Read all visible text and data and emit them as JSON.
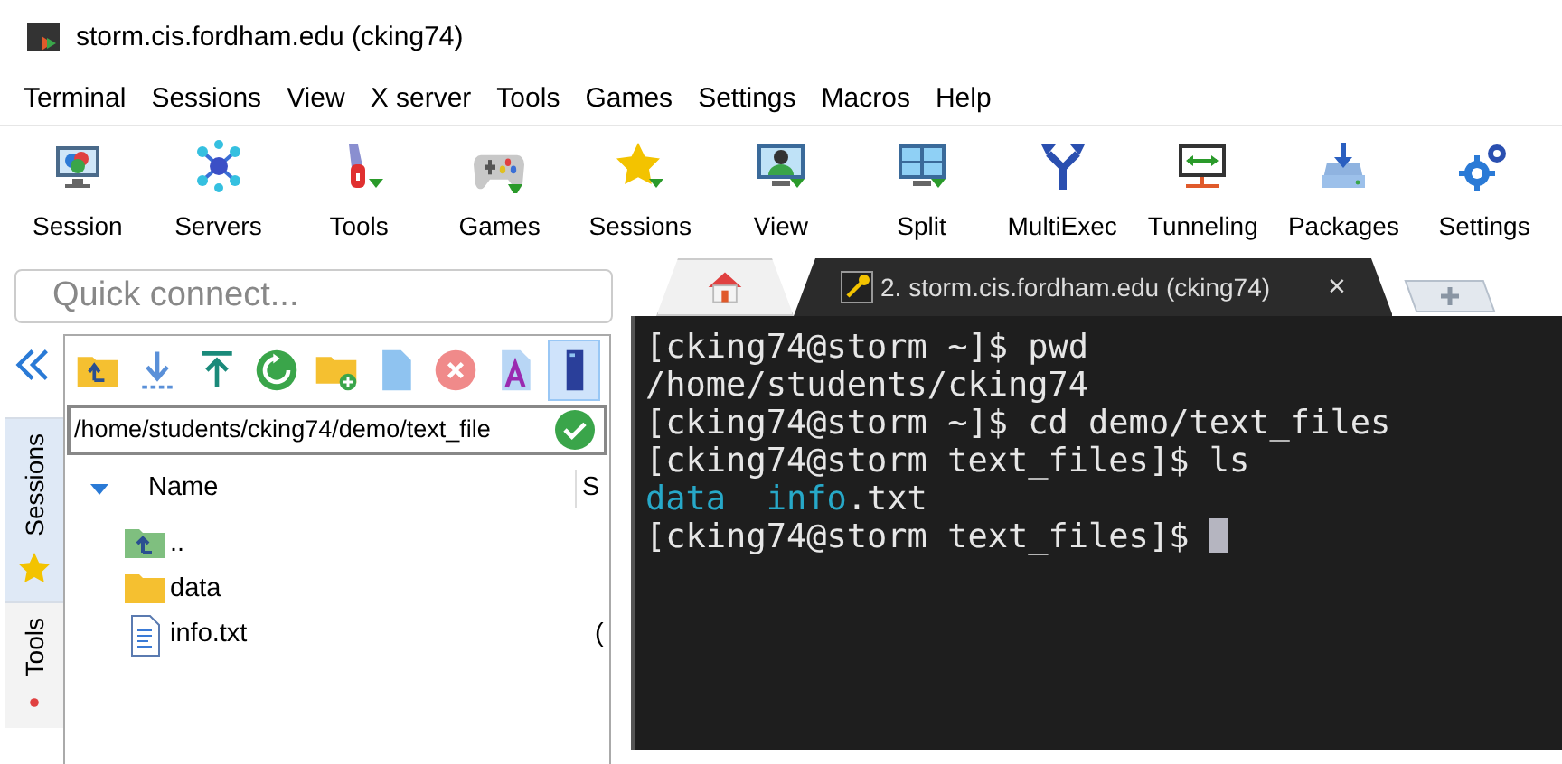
{
  "window": {
    "title": "storm.cis.fordham.edu (cking74)"
  },
  "menu": [
    "Terminal",
    "Sessions",
    "View",
    "X server",
    "Tools",
    "Games",
    "Settings",
    "Macros",
    "Help"
  ],
  "toolbar": [
    {
      "label": "Session"
    },
    {
      "label": "Servers"
    },
    {
      "label": "Tools"
    },
    {
      "label": "Games"
    },
    {
      "label": "Sessions"
    },
    {
      "label": "View"
    },
    {
      "label": "Split"
    },
    {
      "label": "MultiExec"
    },
    {
      "label": "Tunneling"
    },
    {
      "label": "Packages"
    },
    {
      "label": "Settings"
    }
  ],
  "quick_connect": {
    "placeholder": "Quick connect..."
  },
  "side_tabs": [
    {
      "label": "Sessions",
      "selected": true
    },
    {
      "label": "Tools",
      "selected": false
    }
  ],
  "file_toolbar": [
    {
      "selected": false
    },
    {
      "selected": false
    },
    {
      "selected": false
    },
    {
      "selected": false
    },
    {
      "selected": false
    },
    {
      "selected": false
    },
    {
      "selected": false
    },
    {
      "selected": false
    },
    {
      "selected": true
    }
  ],
  "path": {
    "value": "/home/students/cking74/demo/text_file"
  },
  "file_columns": [
    "Name",
    "S"
  ],
  "files": [
    {
      "kind": "parent",
      "name": ".."
    },
    {
      "kind": "folder",
      "name": "data"
    },
    {
      "kind": "file",
      "name": "info.txt",
      "column_2": "("
    }
  ],
  "tabs": [
    {
      "kind": "home",
      "selected": false
    },
    {
      "kind": "session",
      "label": "2. storm.cis.fordham.edu (cking74)",
      "close": "×",
      "selected": true
    }
  ],
  "terminal": [
    [
      {
        "kind": "plain",
        "text": "[cking74@storm ~]$ pwd"
      }
    ],
    [
      {
        "kind": "plain",
        "text": "/home/students/cking74"
      }
    ],
    [
      {
        "kind": "plain",
        "text": "[cking74@storm ~]$ cd demo/text_files"
      }
    ],
    [
      {
        "kind": "plain",
        "text": "[cking74@storm text_files]$ ls"
      }
    ],
    [
      {
        "kind": "dir",
        "text": "data"
      },
      {
        "kind": "dir",
        "text": "info",
        "space_before": true
      },
      {
        "kind": "plain",
        "text": ".txt"
      }
    ],
    [
      {
        "kind": "plain",
        "text": "[cking74@storm text_files]$ "
      },
      {
        "kind": "cursor"
      }
    ]
  ]
}
